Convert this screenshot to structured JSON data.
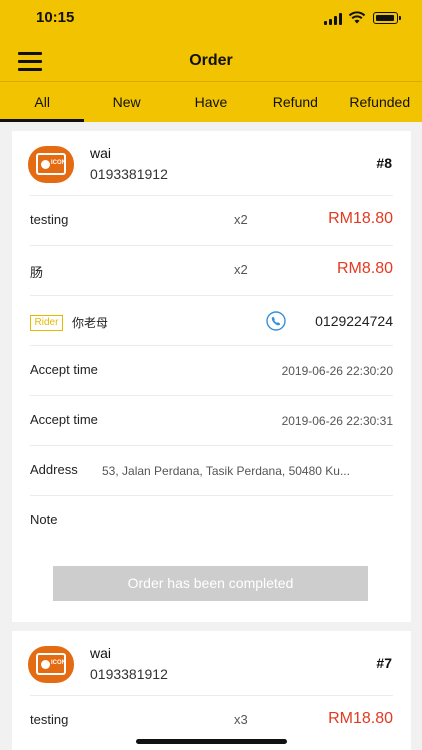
{
  "status_bar": {
    "time": "10:15"
  },
  "header": {
    "title": "Order"
  },
  "tabs": [
    {
      "label": "All",
      "active": true
    },
    {
      "label": "New",
      "active": false
    },
    {
      "label": "Have",
      "active": false
    },
    {
      "label": "Refund",
      "active": false
    },
    {
      "label": "Refunded",
      "active": false
    }
  ],
  "orders": [
    {
      "customer_name": "wai",
      "customer_phone": "0193381912",
      "order_number": "#8",
      "items": [
        {
          "name": "testing",
          "qty": "x2",
          "price": "RM18.80"
        },
        {
          "name": "肠",
          "qty": "x2",
          "price": "RM8.80"
        }
      ],
      "rider_tag": "Rider",
      "rider_name": "你老母",
      "rider_phone": "0129224724",
      "accept_label_1": "Accept time",
      "accept_value_1": "2019-06-26 22:30:20",
      "accept_label_2": "Accept time",
      "accept_value_2": "2019-06-26 22:30:31",
      "address_label": "Address",
      "address_value": "53, Jalan Perdana, Tasik Perdana, 50480 Ku...",
      "note_label": "Note",
      "status_button": "Order has been completed"
    },
    {
      "customer_name": "wai",
      "customer_phone": "0193381912",
      "order_number": "#7",
      "items": [
        {
          "name": "testing",
          "qty": "x3",
          "price": "RM18.80"
        }
      ]
    }
  ],
  "colors": {
    "brand_yellow": "#f2c300",
    "price_red": "#e23b22",
    "rider_tag": "#e5b900"
  }
}
